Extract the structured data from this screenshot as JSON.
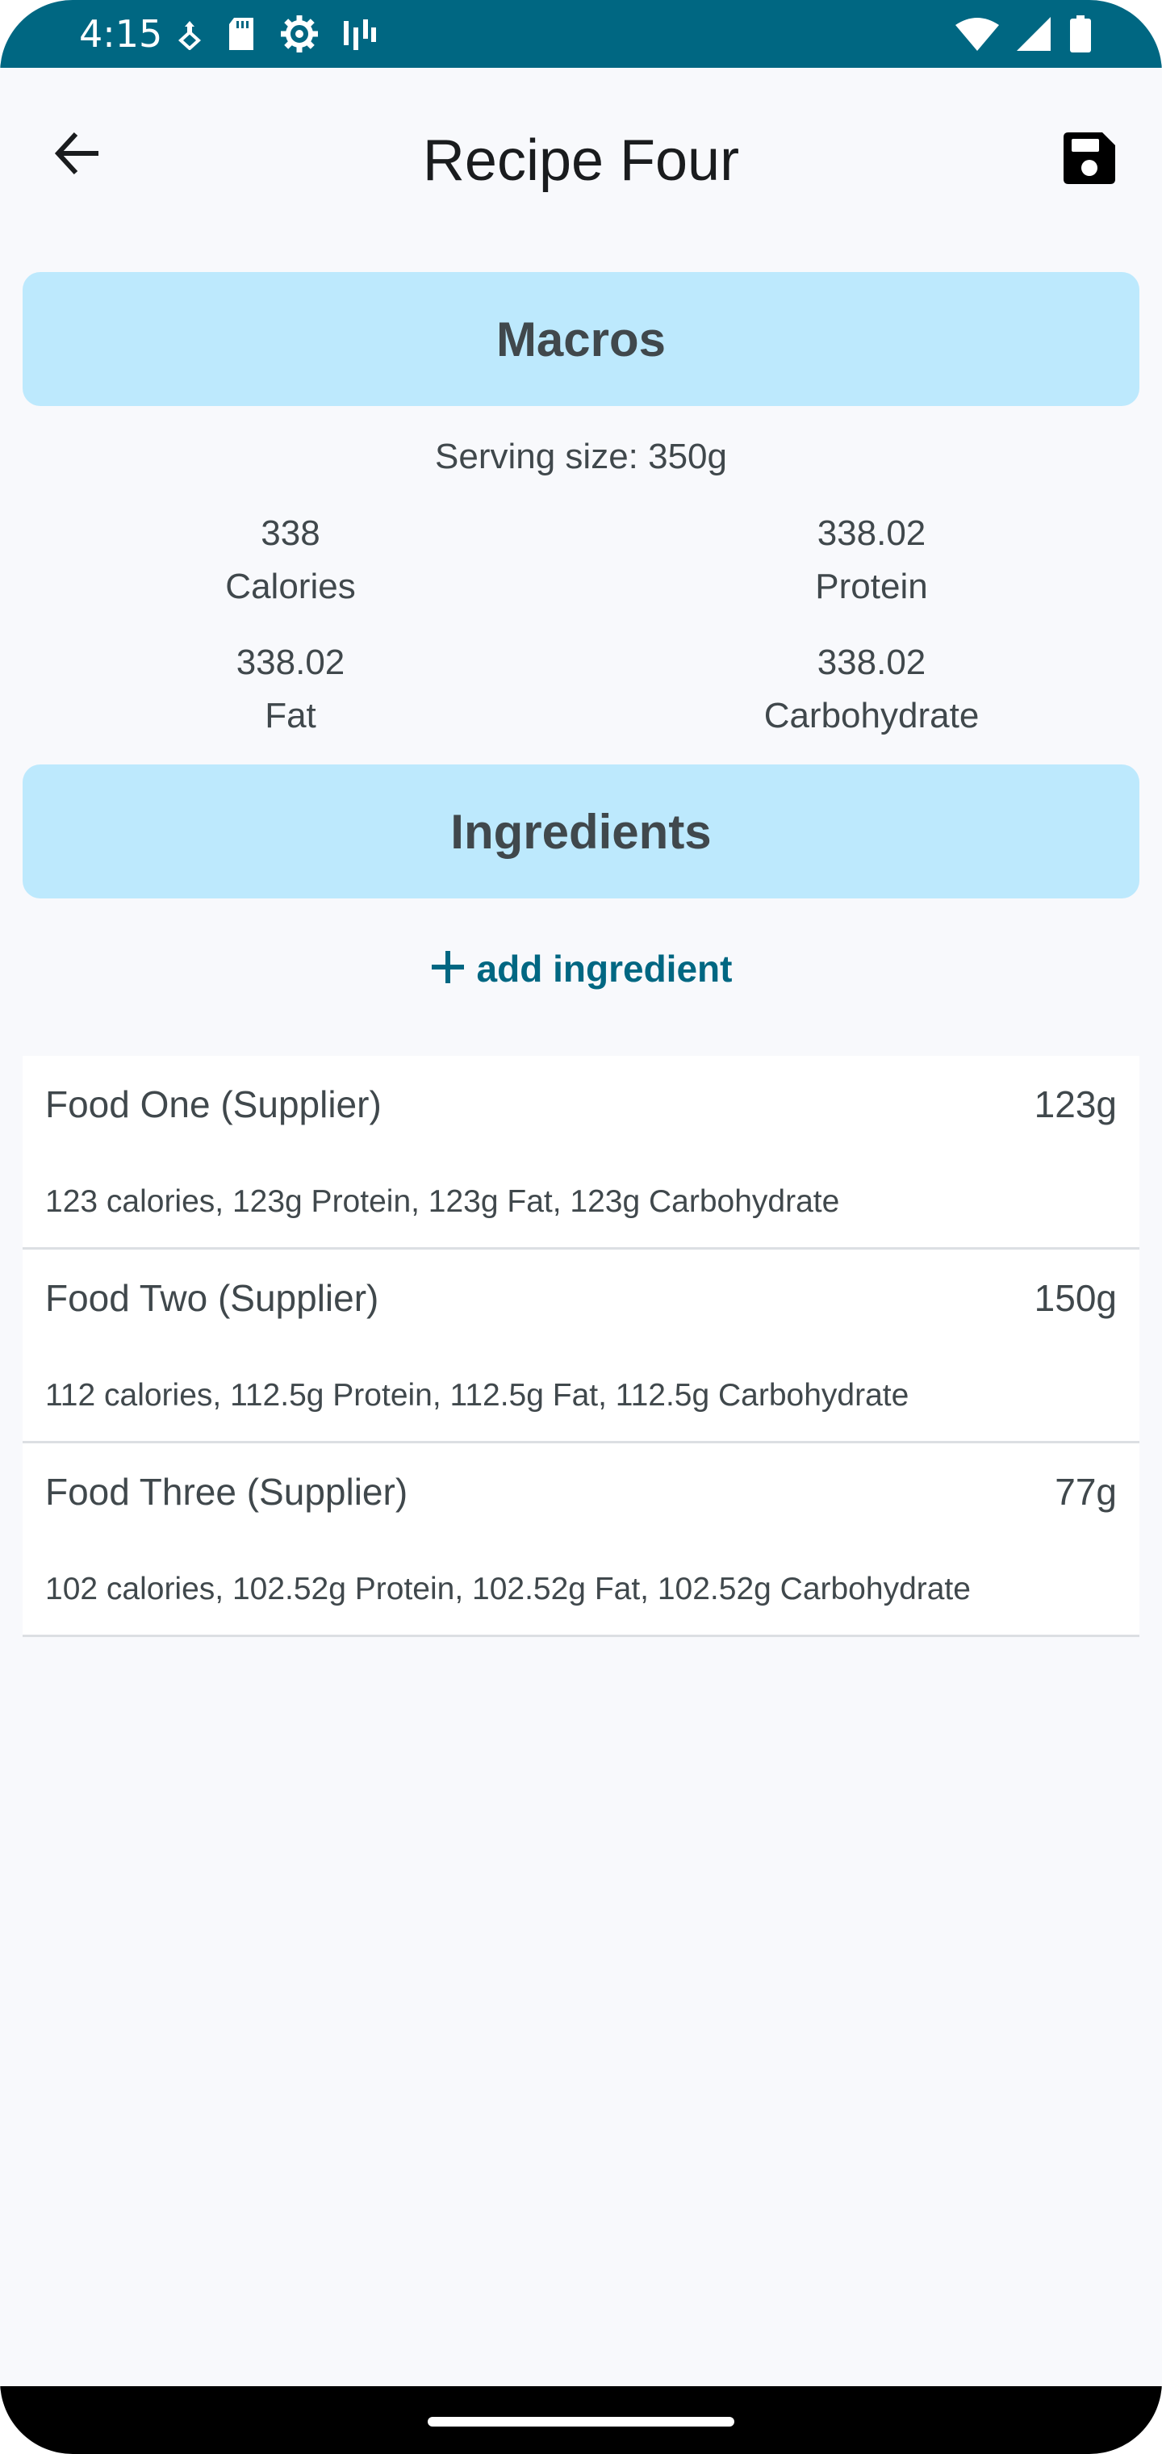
{
  "status_bar": {
    "time": "4:15"
  },
  "app_bar": {
    "title": "Recipe Four",
    "back_icon": "arrow-back-icon",
    "save_icon": "save-icon"
  },
  "macros": {
    "header": "Macros",
    "serving_size": "Serving size: 350g",
    "items": [
      {
        "value": "338",
        "label": "Calories"
      },
      {
        "value": "338.02",
        "label": "Protein"
      },
      {
        "value": "338.02",
        "label": "Fat"
      },
      {
        "value": "338.02",
        "label": "Carbohydrate"
      }
    ]
  },
  "ingredients": {
    "header": "Ingredients",
    "add_label": "add ingredient",
    "items": [
      {
        "name": "Food One (Supplier)",
        "weight": "123g",
        "detail": "123 calories, 123g Protein, 123g Fat, 123g Carbohydrate"
      },
      {
        "name": "Food Two (Supplier)",
        "weight": "150g",
        "detail": "112 calories, 112.5g Protein, 112.5g Fat, 112.5g Carbohydrate"
      },
      {
        "name": "Food Three (Supplier)",
        "weight": "77g",
        "detail": "102 calories, 102.52g Protein, 102.52g Fat, 102.52g Carbohydrate"
      }
    ]
  },
  "colors": {
    "status_bar": "#006782",
    "header_card": "#bde9fd",
    "accent": "#006782",
    "background": "#f8f9fc",
    "text": "#40484c"
  }
}
